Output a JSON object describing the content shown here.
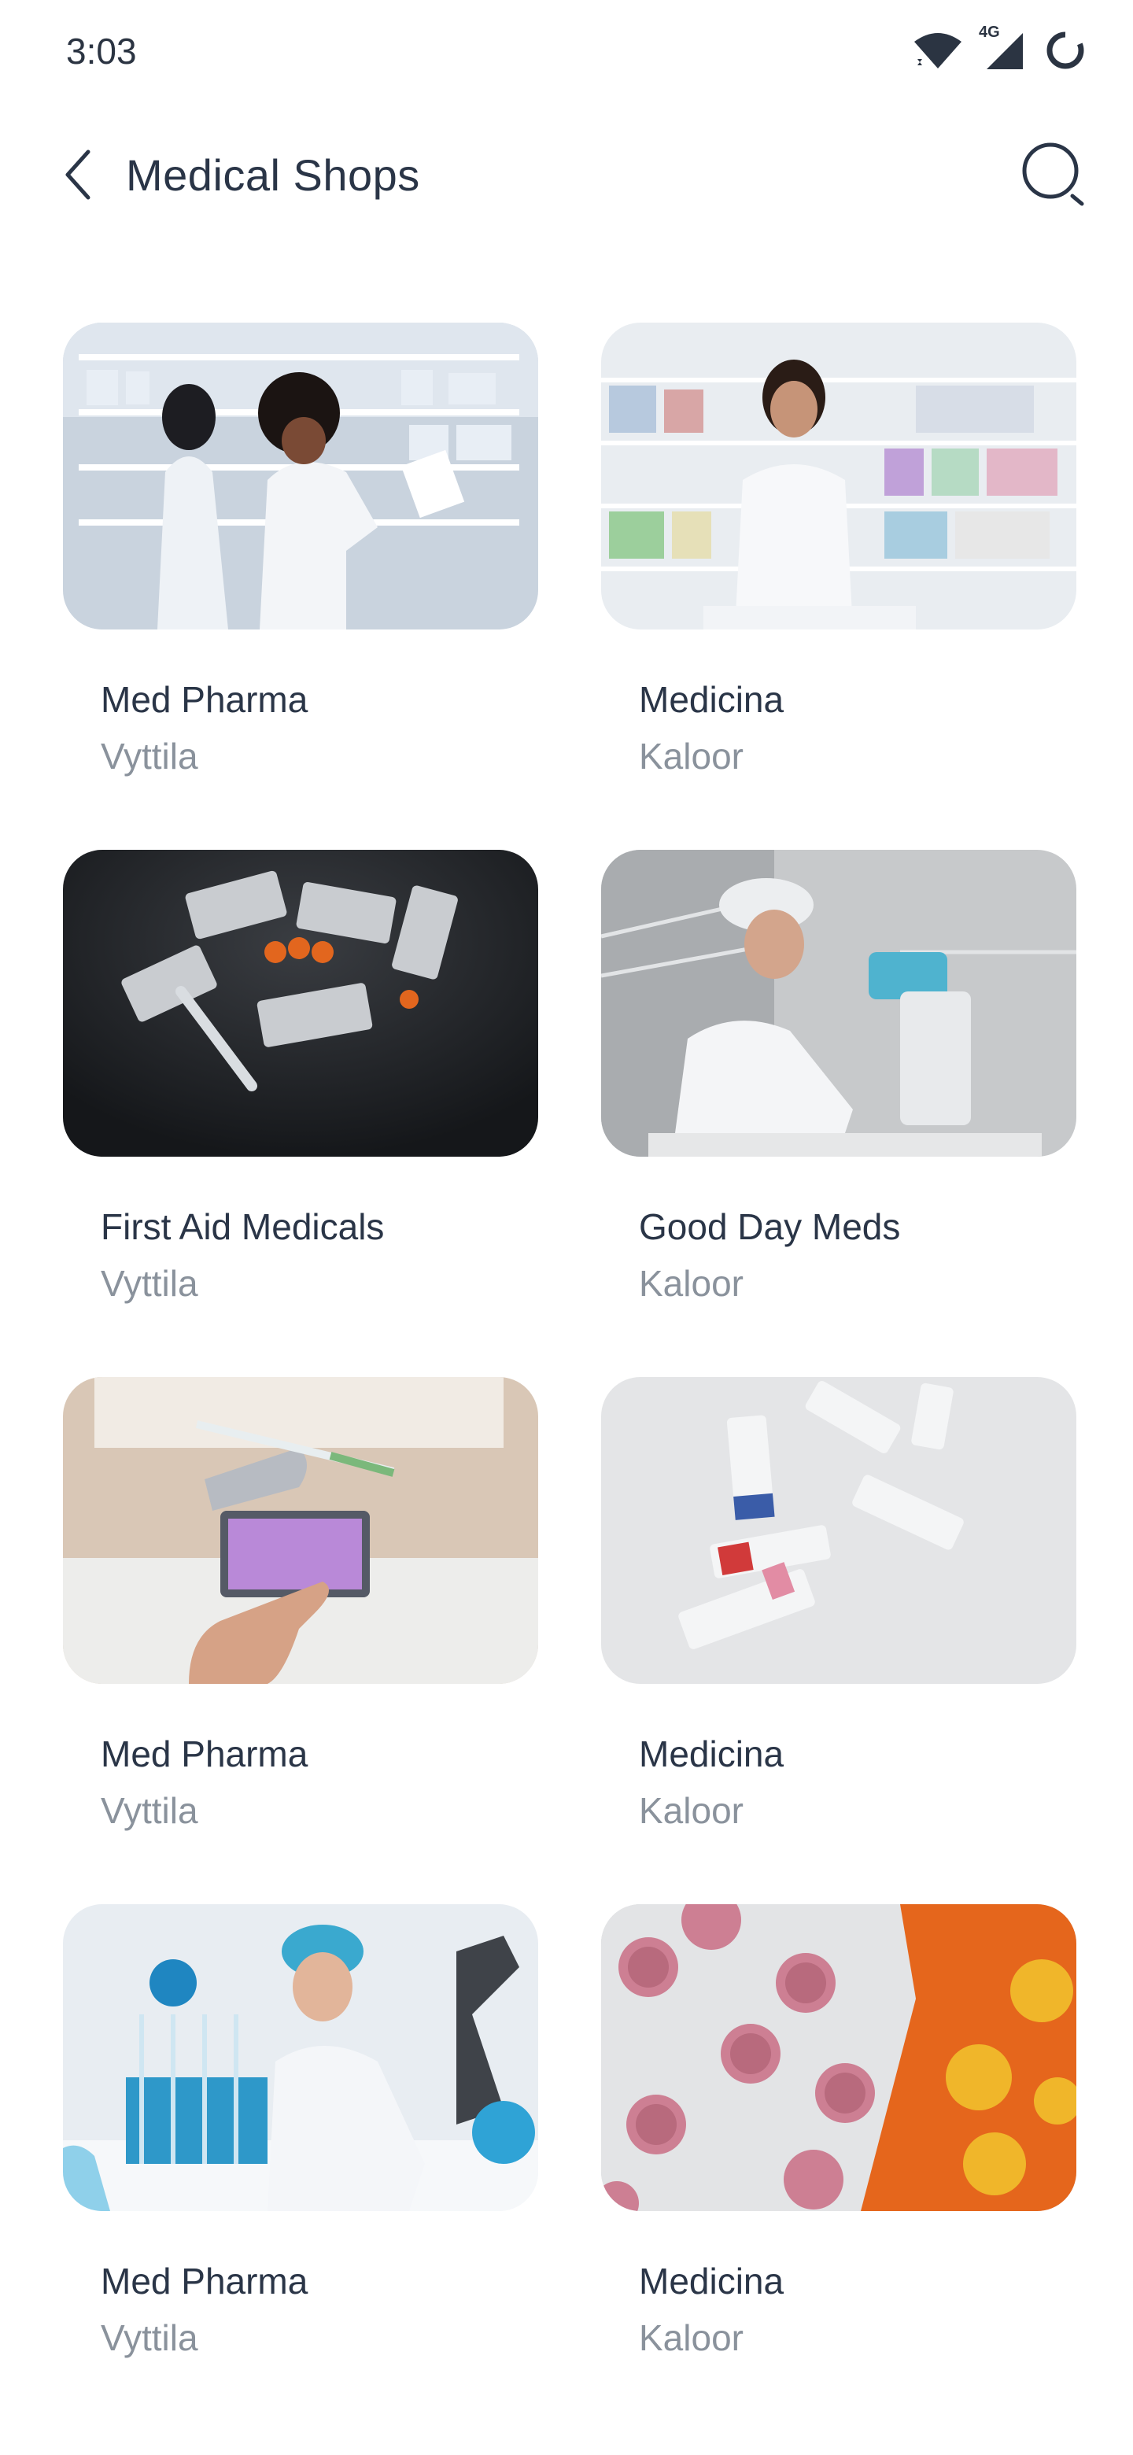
{
  "status_bar": {
    "time": "3:03",
    "network_label": "4G",
    "icons": [
      "wifi-icon",
      "cellular-signal-icon",
      "battery-icon"
    ]
  },
  "header": {
    "title": "Medical Shops",
    "back_icon": "chevron-left-icon",
    "search_icon": "search-icon"
  },
  "shops": [
    {
      "name": "Med Pharma",
      "location": "Vyttila",
      "image": "pharmacists-at-shelves"
    },
    {
      "name": "Medicina",
      "location": "Kaloor",
      "image": "smiling-pharmacist"
    },
    {
      "name": "First Aid Medicals",
      "location": "Vyttila",
      "image": "pill-blisters-thermometer"
    },
    {
      "name": "Good Day Meds",
      "location": "Kaloor",
      "image": "scientist-microscope"
    },
    {
      "name": "Med Pharma",
      "location": "Vyttila",
      "image": "hand-floating-syringe"
    },
    {
      "name": "Medicina",
      "location": "Kaloor",
      "image": "ointment-tubes"
    },
    {
      "name": "Med Pharma",
      "location": "Vyttila",
      "image": "lab-chemist-test-tubes"
    },
    {
      "name": "Medicina",
      "location": "Kaloor",
      "image": "pink-pill-blister"
    }
  ],
  "colors": {
    "title": "#2a3547",
    "subtitle": "#8a929c",
    "background": "#ffffff"
  }
}
